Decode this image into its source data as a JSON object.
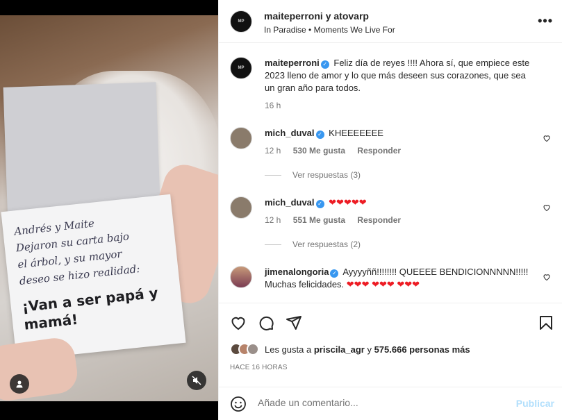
{
  "media": {
    "note_lines": [
      "Andrés y Maite",
      "Dejaron su carta bajo",
      "el árbol, y su mayor",
      "deseo se hizo realidad:"
    ],
    "note_highlight": "¡Van a ser papá y mamá!",
    "user_icon": "user-icon",
    "mute_icon": "muted-speaker-icon"
  },
  "header": {
    "title": "maiteperroni y atovarp",
    "subtitle": "In Paradise • Moments We Live For",
    "more_icon": "more-horizontal-icon",
    "more_glyph": "•••"
  },
  "caption": {
    "username": "maiteperroni",
    "text": "Feliz día de reyes !!!! Ahora sí, que empiece este 2023 lleno de amor y lo que más deseen sus corazones, que sea un gran año para todos.",
    "time": "16 h"
  },
  "comments": [
    {
      "username": "mich_duval",
      "text": "KHEEEEEEE",
      "time": "12 h",
      "likes": "530 Me gusta",
      "reply": "Responder",
      "view_replies": "Ver respuestas (3)"
    },
    {
      "username": "mich_duval",
      "text": "❤❤❤❤❤",
      "time": "12 h",
      "likes": "551 Me gusta",
      "reply": "Responder",
      "view_replies": "Ver respuestas (2)"
    },
    {
      "username": "jimenalongoria",
      "text_before": "Ayyyyññ!!!!!!!! QUEEEE BENDICIONNNNN!!!!! Muchas felicidades. ",
      "hearts": "❤❤❤ ❤❤❤ ❤❤❤"
    }
  ],
  "actions": {
    "like_icon": "heart-icon",
    "comment_icon": "comment-icon",
    "share_icon": "share-icon",
    "save_icon": "bookmark-icon"
  },
  "likes": {
    "prefix": "Les gusta a ",
    "user": "priscila_agr",
    "middle": " y ",
    "count": "575.666 personas más"
  },
  "time_ago": "HACE 16 HORAS",
  "composer": {
    "emoji_icon": "smiley-icon",
    "placeholder": "Añade un comentario...",
    "post_label": "Publicar"
  },
  "colors": {
    "verified": "#3897f0",
    "post_disabled": "#b2dffc",
    "heart_emoji": "#ed1c24"
  }
}
